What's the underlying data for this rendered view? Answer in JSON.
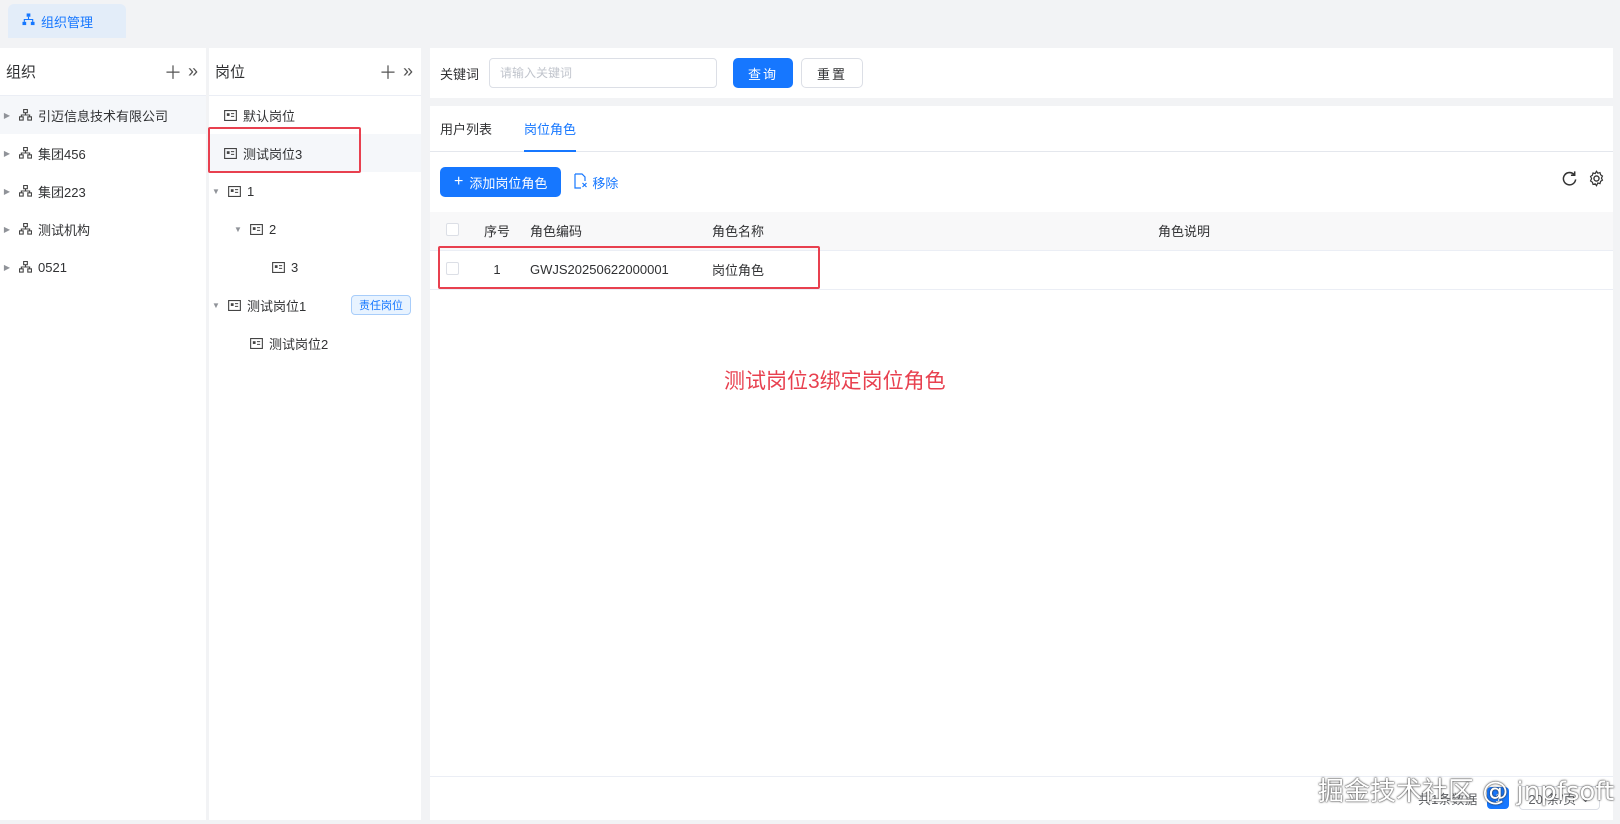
{
  "page_tab": {
    "label": "组织管理",
    "icon": "org-chart-icon"
  },
  "org_panel": {
    "title": "组织",
    "items": [
      {
        "label": "引迈信息技术有限公司"
      },
      {
        "label": "集团456"
      },
      {
        "label": "集团223"
      },
      {
        "label": "测试机构"
      },
      {
        "label": "0521"
      }
    ]
  },
  "post_panel": {
    "title": "岗位",
    "items": [
      {
        "label": "默认岗位"
      },
      {
        "label": "测试岗位3"
      },
      {
        "label": "1"
      },
      {
        "label": "2"
      },
      {
        "label": "3"
      },
      {
        "label": "测试岗位1",
        "tag": "责任岗位"
      },
      {
        "label": "测试岗位2"
      }
    ]
  },
  "search": {
    "label": "关键词",
    "placeholder": "请输入关键词",
    "query_label": "查询",
    "reset_label": "重置"
  },
  "tabs": [
    {
      "label": "用户列表"
    },
    {
      "label": "岗位角色"
    }
  ],
  "toolbar": {
    "add_label": "添加岗位角色",
    "remove_label": "移除"
  },
  "table": {
    "columns": [
      "序号",
      "角色编码",
      "角色名称",
      "角色说明"
    ],
    "rows": [
      {
        "index": "1",
        "code": "GWJS20250622000001",
        "name": "岗位角色",
        "desc": ""
      }
    ]
  },
  "annotation": {
    "text": "测试岗位3绑定岗位角色",
    "color": "#e8404f"
  },
  "pager": {
    "total_label": "共1条数据",
    "current_page": "1",
    "page_size_label": "20 条/页"
  },
  "watermark": "掘金技术社区 @ jnpfsoft",
  "colors": {
    "primary": "#1677ff",
    "annotation": "#e8404f"
  }
}
